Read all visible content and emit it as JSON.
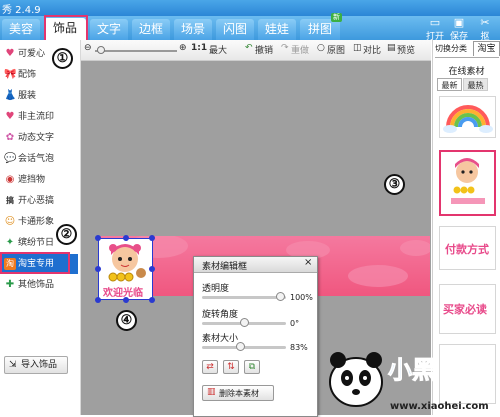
{
  "app": {
    "title": "秀 2.4.9"
  },
  "tabs": [
    {
      "label": "美容"
    },
    {
      "label": "饰品",
      "active": true
    },
    {
      "label": "文字"
    },
    {
      "label": "边框"
    },
    {
      "label": "场景"
    },
    {
      "label": "闪图"
    },
    {
      "label": "娃娃"
    },
    {
      "label": "拼图",
      "badge": "新"
    }
  ],
  "right_tools": [
    {
      "icon": "folder-open-icon",
      "label": "打开"
    },
    {
      "icon": "save-icon",
      "label": "保存"
    },
    {
      "icon": "cutout-icon",
      "label": "抠"
    }
  ],
  "toolbar": {
    "zoom_label": "1:1",
    "max_label": "最大",
    "undo": "撤销",
    "redo": "重做",
    "original": "原图",
    "compare": "对比",
    "preview": "预览"
  },
  "sidebar": {
    "items": [
      {
        "label": "可爱心",
        "icon": "♥"
      },
      {
        "label": "配饰",
        "icon": "🎀"
      },
      {
        "label": "服装",
        "icon": "👗"
      },
      {
        "label": "非主流印",
        "icon": "♥"
      },
      {
        "label": "动态文字",
        "icon": "✿"
      },
      {
        "label": "会话气泡",
        "icon": "💬"
      },
      {
        "label": "遮挡物",
        "icon": "◉"
      },
      {
        "label": "开心恶搞",
        "icon": "搞"
      },
      {
        "label": "卡通形象",
        "icon": "☺"
      },
      {
        "label": "缤纷节日",
        "icon": "✦"
      },
      {
        "label": "淘宝专用",
        "icon": "淘",
        "active": true
      },
      {
        "label": "其他饰品",
        "icon": "✚"
      }
    ],
    "import_button": "导入饰品"
  },
  "dialog": {
    "title": "素材编辑框",
    "opacity_label": "透明度",
    "opacity_value": "100%",
    "rotate_label": "旋转角度",
    "rotate_value": "0°",
    "size_label": "素材大小",
    "size_value": "83%",
    "delete_button": "删除本素材"
  },
  "right_panel": {
    "category_tab": "切换分类",
    "current_tab": "淘宝",
    "online_header": "在线素材",
    "sort_latest": "最新",
    "sort_hot": "最热",
    "thumb_payment": "付款方式",
    "thumb_must_see": "买家必读"
  },
  "sticker_text": "欢迎光临",
  "annotations": [
    "①",
    "②",
    "③",
    "④"
  ],
  "watermark": {
    "brand": "小黑游戏",
    "url": "www.xiaohei.com"
  },
  "colors": {
    "accent": "#2f8fdc",
    "highlight": "#e3356e",
    "banner": "#f36a8f"
  }
}
